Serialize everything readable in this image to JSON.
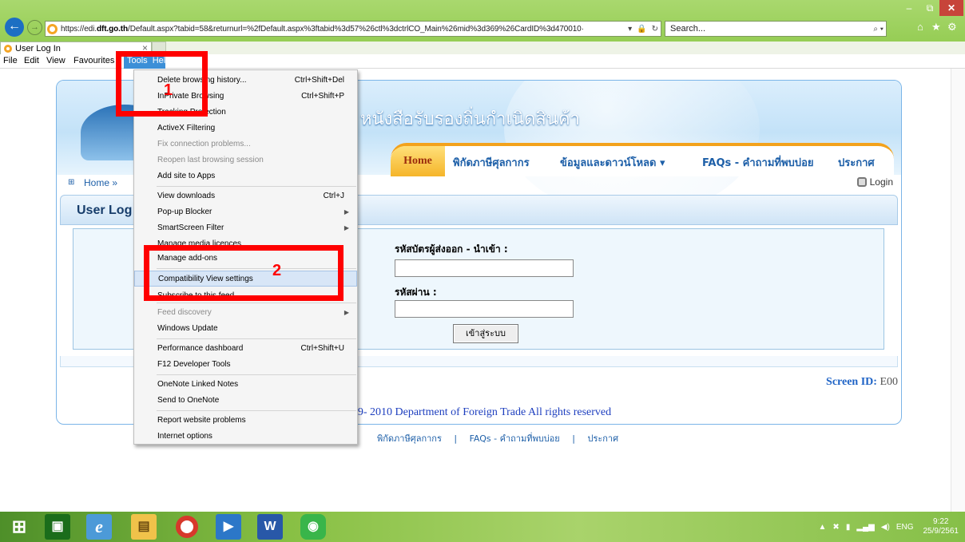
{
  "browser": {
    "url_prefix": "https://edi.",
    "url_domain": "dft.go.th",
    "url_rest": "/Default.aspx?tabid=58&returnurl=%2fDefault.aspx%3ftabid%3d57%26ctl%3dctrlCO_Main%26mid%3d369%26CardID%3d470010·",
    "search_placeholder": "Search...",
    "tab_title": "User Log In",
    "window_min": "–",
    "window_max": "⧉",
    "window_close": "✕"
  },
  "menubar": {
    "file": "File",
    "edit": "Edit",
    "view": "View",
    "favourites": "Favourites",
    "tools": "Tools",
    "help": "Help"
  },
  "tools_menu": {
    "items": [
      {
        "label": "Delete browsing history...",
        "shortcut": "Ctrl+Shift+Del"
      },
      {
        "label": "InPrivate Browsing",
        "shortcut": "Ctrl+Shift+P"
      },
      {
        "label": "Tracking Protection",
        "shortcut": ""
      },
      {
        "label": "ActiveX Filtering",
        "shortcut": ""
      },
      {
        "label": "Fix connection problems...",
        "shortcut": ""
      },
      {
        "label": "Reopen last browsing session",
        "shortcut": ""
      },
      {
        "label": "Add site to Apps",
        "shortcut": ""
      },
      {
        "label": "View downloads",
        "shortcut": "Ctrl+J"
      },
      {
        "label": "Pop-up Blocker",
        "shortcut": ""
      },
      {
        "label": "SmartScreen Filter",
        "shortcut": ""
      },
      {
        "label": "Manage media licences",
        "shortcut": ""
      },
      {
        "label": "Manage add-ons",
        "shortcut": ""
      },
      {
        "label": "Compatibility View settings",
        "shortcut": ""
      },
      {
        "label": "Subscribe to this feed...",
        "shortcut": ""
      },
      {
        "label": "Feed discovery",
        "shortcut": ""
      },
      {
        "label": "Windows Update",
        "shortcut": ""
      },
      {
        "label": "Performance dashboard",
        "shortcut": "Ctrl+Shift+U"
      },
      {
        "label": "F12 Developer Tools",
        "shortcut": ""
      },
      {
        "label": "OneNote Linked Notes",
        "shortcut": ""
      },
      {
        "label": "Send to OneNote",
        "shortcut": ""
      },
      {
        "label": "Report website problems",
        "shortcut": ""
      },
      {
        "label": "Internet options",
        "shortcut": ""
      }
    ]
  },
  "annotations": {
    "step1": "1",
    "step2": "2",
    "color": "#ff0000"
  },
  "site": {
    "banner_title": "หนังสือรับรองถิ่นกำเนิดสินค้า",
    "nav": {
      "home": "Home",
      "tariff": "พิกัดภาษีศุลกากร",
      "downloads": "ข้อมูลและดาวน์โหลด ▾",
      "faqs": "FAQs - คำถามที่พบบ่อย",
      "announce": "ประกาศ"
    },
    "breadcrumb_home": "Home »",
    "login_link": "Login",
    "pane_title": "User Log",
    "exporter_id_label": "รหัสบัตรผู้ส่งออก - นำเข้า :",
    "exporter_id_value": "",
    "password_label": "รหัสผ่าน :",
    "password_value": "",
    "login_button": "เข้าสู่ระบบ",
    "screen_id_label": "Screen ID:",
    "screen_id_value": "E00",
    "copyright": "009- 2010 Department of Foreign Trade All rights reserved",
    "footer_links": [
      "พิกัดภาษีศุลกากร",
      "|",
      "FAQs - คำถามที่พบบ่อย",
      "|",
      "ประกาศ"
    ]
  },
  "taskbar": {
    "language": "ENG",
    "time": "9:22",
    "date": "25/9/2561"
  }
}
